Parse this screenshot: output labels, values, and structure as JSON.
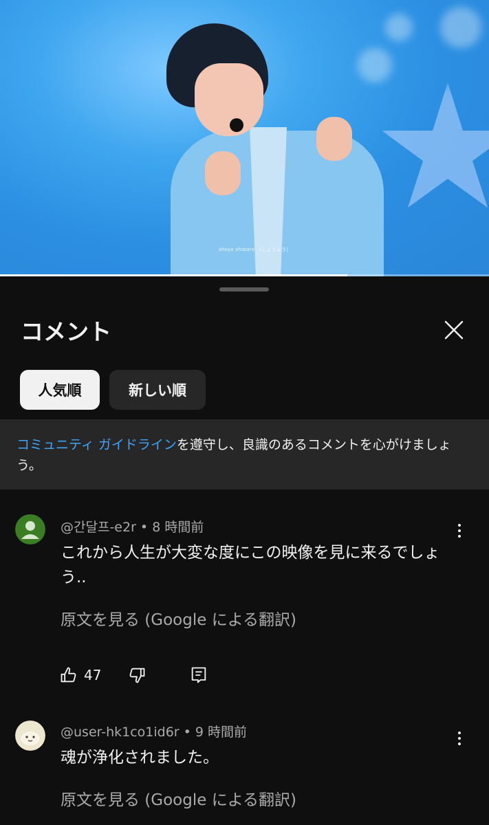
{
  "video": {
    "caption": "shoyo shotaro　(しょうよう)",
    "progress_fraction": 0.71
  },
  "sheet": {
    "title": "コメント",
    "close_icon": "close-icon"
  },
  "sort_chips": [
    {
      "label": "人気順",
      "active": true
    },
    {
      "label": "新しい順",
      "active": false
    }
  ],
  "guidelines": {
    "link_text": "コミュニティ ガイドライン",
    "text": "を遵守し、良識のあるコメントを心がけましょう。"
  },
  "comments": [
    {
      "author": "@간달프-e2r",
      "time": "8 時間前",
      "separator": " • ",
      "text": "これから人生が大変な度にこの映像を見に来るでしょう..",
      "translate_label": "原文を見る (Google による翻訳)",
      "likes": "47",
      "avatar_color": "#3a7d22"
    },
    {
      "author": "@user-hk1co1id6r",
      "time": "9 時間前",
      "separator": " • ",
      "text": "魂が浄化されました。",
      "translate_label": "原文を見る (Google による翻訳)",
      "avatar_color": "#ede7cf"
    }
  ]
}
